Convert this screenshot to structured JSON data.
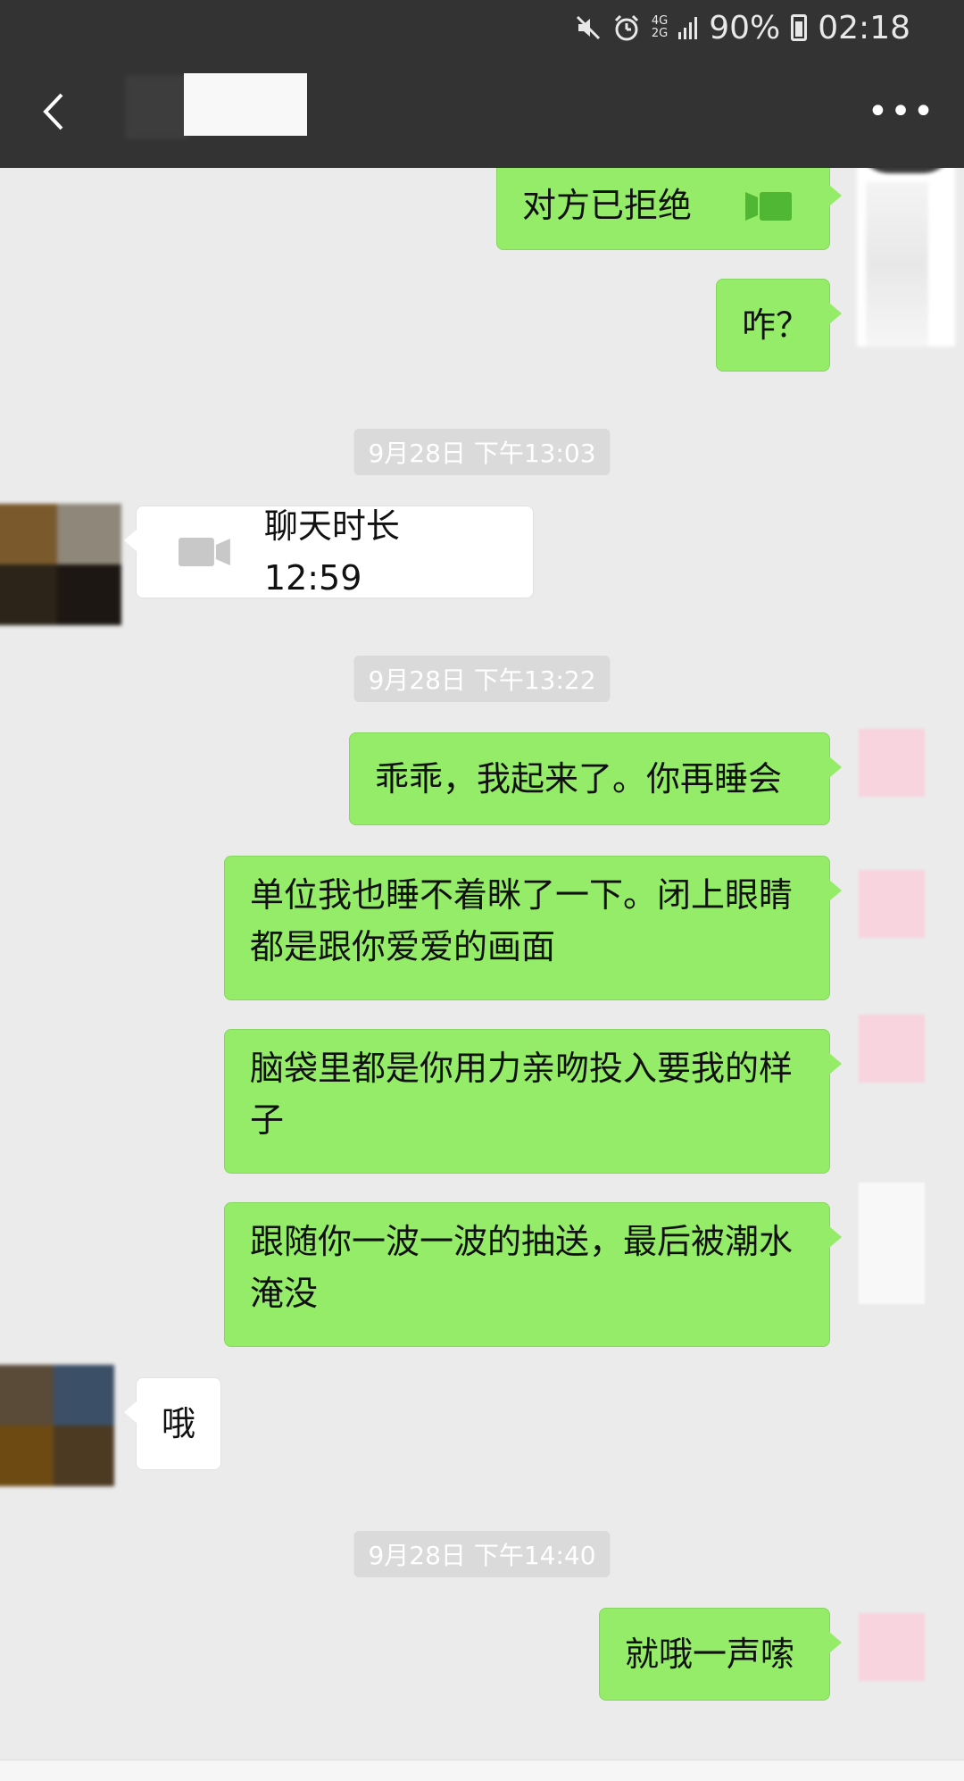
{
  "status_bar": {
    "network_4g": "4G",
    "network_2g": "2G",
    "battery": "90%",
    "time": "02:18"
  },
  "header": {
    "back_icon": "chevron-left-icon",
    "more_icon": "more-icon",
    "more_glyph": "•••"
  },
  "messages": {
    "m1": "对方已拒绝",
    "m2": "咋？",
    "ts1": "9月28日 下午13:03",
    "m3": "聊天时长 12:59",
    "ts2": "9月28日 下午13:22",
    "m4": "乖乖，我起来了。你再睡会",
    "m5": "单位我也睡不着眯了一下。闭上眼睛都是跟你爱爱的画面",
    "m6": "脑袋里都是你用力亲吻投入要我的样子",
    "m7": "跟随你一波一波的抽送，最后被潮水淹没",
    "m8": "哦",
    "ts3": "9月28日 下午14:40",
    "m9": "就哦一声嗦"
  },
  "colors": {
    "header_bg": "#333333",
    "chat_bg": "#ebebeb",
    "outgoing_bubble": "#95ec69",
    "incoming_bubble": "#ffffff",
    "timestamp_bg": "#dadada"
  }
}
